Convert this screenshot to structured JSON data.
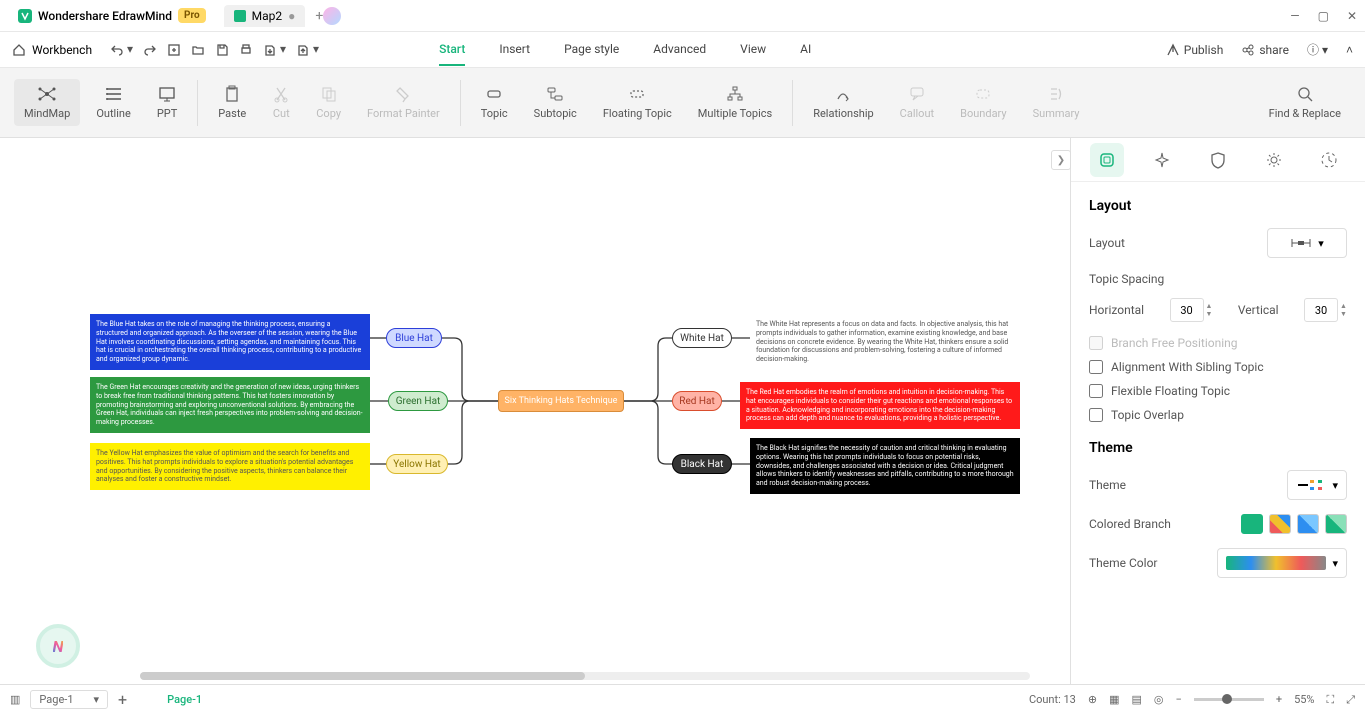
{
  "titlebar": {
    "app": "Wondershare EdrawMind",
    "pro": "Pro",
    "doc": "Map2"
  },
  "menubar": {
    "workbench": "Workbench",
    "tabs": [
      "Start",
      "Insert",
      "Page style",
      "Advanced",
      "View",
      "AI"
    ],
    "active": "Start",
    "publish": "Publish",
    "share": "share"
  },
  "ribbon": {
    "mindmap": "MindMap",
    "outline": "Outline",
    "ppt": "PPT",
    "paste": "Paste",
    "cut": "Cut",
    "copy": "Copy",
    "format": "Format Painter",
    "topic": "Topic",
    "subtopic": "Subtopic",
    "floating": "Floating Topic",
    "multiple": "Multiple Topics",
    "relation": "Relationship",
    "callout": "Callout",
    "boundary": "Boundary",
    "summary": "Summary",
    "find": "Find & Replace"
  },
  "panel": {
    "layout_h": "Layout",
    "layout_l": "Layout",
    "spacing_h": "Topic Spacing",
    "horiz": "Horizontal",
    "vert": "Vertical",
    "hval": "30",
    "vval": "30",
    "free": "Branch Free Positioning",
    "align": "Alignment With Sibling Topic",
    "flex": "Flexible Floating Topic",
    "overlap": "Topic Overlap",
    "theme_h": "Theme",
    "theme_l": "Theme",
    "colored": "Colored Branch",
    "themecolor": "Theme Color"
  },
  "map": {
    "center": "Six Thinking Hats Technique",
    "blue": "Blue Hat",
    "green": "Green Hat",
    "yellow": "Yellow Hat",
    "white": "White Hat",
    "red": "Red Hat",
    "black": "Black Hat",
    "blue_t": "The Blue Hat takes on the role of managing the thinking process, ensuring a structured and organized approach. As the overseer of the session, wearing the Blue Hat involves coordinating discussions, setting agendas, and maintaining focus. This hat is crucial in orchestrating the overall thinking process, contributing to a productive and organized group dynamic.",
    "green_t": "The Green Hat encourages creativity and the generation of new ideas, urging thinkers to break free from traditional thinking patterns. This hat fosters innovation by promoting brainstorming and exploring unconventional solutions. By embracing the Green Hat, individuals can inject fresh perspectives into problem-solving and decision-making processes.",
    "yellow_t": "The Yellow Hat emphasizes the value of optimism and the search for benefits and positives. This hat prompts individuals to explore a situation's potential advantages and opportunities. By considering the positive aspects, thinkers can balance their analyses and foster a constructive mindset.",
    "white_t": "The White Hat represents a focus on data and facts. In objective analysis, this hat prompts individuals to gather information, examine existing knowledge, and base decisions on concrete evidence. By wearing the White Hat, thinkers ensure a solid foundation for discussions and problem-solving, fostering a culture of informed decision-making.",
    "red_t": "The Red Hat embodies the realm of emotions and intuition in decision-making. This hat encourages individuals to consider their gut reactions and emotional responses to a situation. Acknowledging and incorporating emotions into the decision-making process can add depth and nuance to evaluations, providing a holistic perspective.",
    "black_t": "The Black Hat signifies the necessity of caution and critical thinking in evaluating options. Wearing this hat prompts individuals to focus on potential risks, downsides, and challenges associated with a decision or idea. Critical judgment allows thinkers to identify weaknesses and pitfalls, contributing to a more thorough and robust decision-making process."
  },
  "status": {
    "page": "Page-1",
    "pagetab": "Page-1",
    "count": "Count: 13",
    "zoom": "55%"
  }
}
